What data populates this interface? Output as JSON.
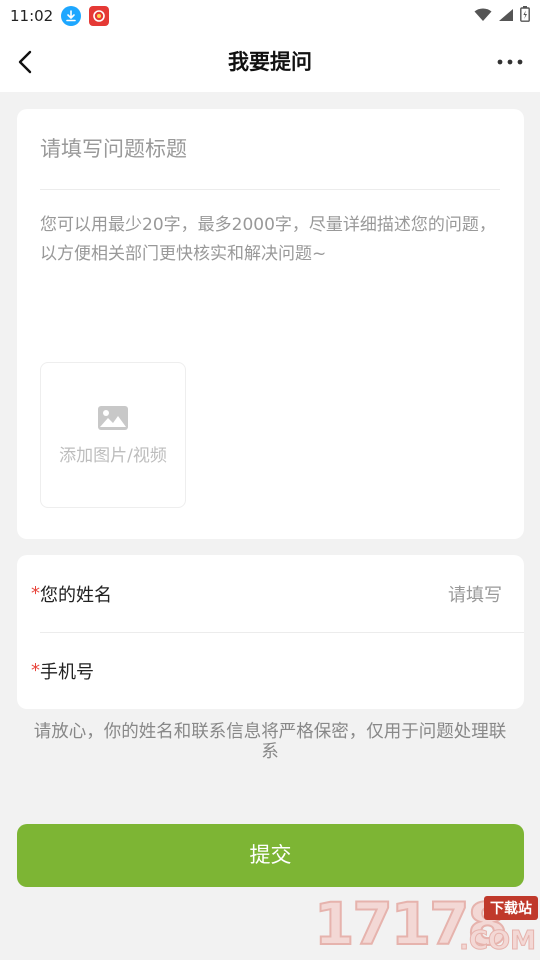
{
  "status_bar": {
    "time": "11:02",
    "icons": [
      "download-icon",
      "app-icon",
      "wifi-icon",
      "signal-icon",
      "battery-icon"
    ]
  },
  "nav": {
    "title": "我要提问",
    "back_icon": "chevron-left-icon",
    "more_icon": "more-dots-icon"
  },
  "question": {
    "title_placeholder": "请填写问题标题",
    "desc_placeholder": "您可以用最少20字，最多2000字，尽量详细描述您的问题，以方便相关部门更快核实和解决问题~",
    "add_media_label": "添加图片/视频",
    "add_media_icon": "image-icon"
  },
  "contact": {
    "required_mark": "*",
    "name_label": "您的姓名",
    "name_placeholder": "请填写",
    "phone_label": "手机号",
    "phone_placeholder": ""
  },
  "privacy_note": "请放心，你的姓名和联系信息将严格保密，仅用于问题处理联系",
  "submit_label": "提交",
  "watermark": {
    "number": "17178",
    "badge": "下载站",
    "suffix": ".COM"
  },
  "colors": {
    "accent": "#7db534",
    "required": "#e8453c",
    "placeholder": "#999999",
    "background": "#f2f2f2"
  }
}
